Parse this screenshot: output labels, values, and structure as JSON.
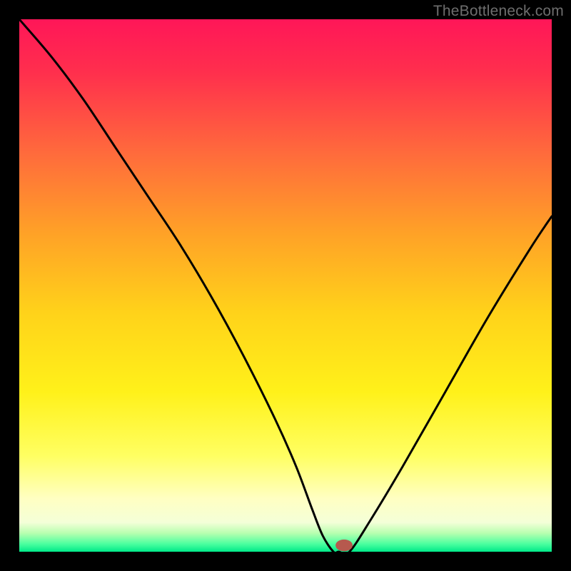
{
  "attribution": "TheBottleneck.com",
  "colors": {
    "frame": "#000000",
    "curve_stroke": "#000000",
    "marker_fill": "#b6594e",
    "gradient_stops": [
      {
        "offset": 0.0,
        "color": "#ff1658"
      },
      {
        "offset": 0.1,
        "color": "#ff2f4d"
      },
      {
        "offset": 0.25,
        "color": "#ff6a3c"
      },
      {
        "offset": 0.4,
        "color": "#ffa127"
      },
      {
        "offset": 0.55,
        "color": "#ffd21a"
      },
      {
        "offset": 0.7,
        "color": "#fff11a"
      },
      {
        "offset": 0.82,
        "color": "#ffff62"
      },
      {
        "offset": 0.9,
        "color": "#ffffc2"
      },
      {
        "offset": 0.945,
        "color": "#f4ffd8"
      },
      {
        "offset": 0.965,
        "color": "#b8ffb0"
      },
      {
        "offset": 0.985,
        "color": "#4dffa0"
      },
      {
        "offset": 1.0,
        "color": "#00e989"
      }
    ]
  },
  "chart_data": {
    "type": "line",
    "title": "",
    "xlabel": "",
    "ylabel": "",
    "xlim": [
      0,
      100
    ],
    "ylim": [
      0,
      100
    ],
    "series": [
      {
        "name": "bottleneck-curve",
        "x": [
          0,
          6,
          12,
          18,
          24,
          30,
          36,
          42,
          48,
          52,
          55,
          57,
          59,
          60,
          62,
          66,
          72,
          80,
          88,
          96,
          100
        ],
        "y": [
          100,
          93,
          85,
          76,
          67,
          58,
          48,
          37,
          25,
          16,
          8,
          3,
          0,
          0,
          0,
          6,
          16,
          30,
          44,
          57,
          63
        ]
      }
    ],
    "marker": {
      "x": 61,
      "y": 1.2,
      "rx": 1.6,
      "ry": 1.1
    }
  }
}
